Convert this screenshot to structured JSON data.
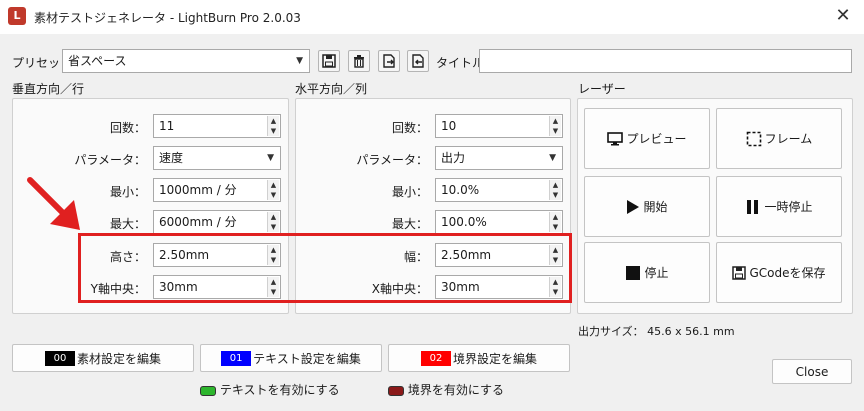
{
  "window": {
    "title": "素材テストジェネレータ - LightBurn Pro 2.0.03",
    "close_glyph": "✕"
  },
  "preset": {
    "label": "プリセット",
    "value": "省スペース",
    "title_label": "タイトル",
    "title_value": ""
  },
  "vertical": {
    "header": "垂直方向／行",
    "count_label": "回数：",
    "count_value": "11",
    "param_label": "パラメータ：",
    "param_value": "速度",
    "min_label": "最小：",
    "min_value": "1000mm / 分",
    "max_label": "最大：",
    "max_value": "6000mm / 分",
    "height_label": "高さ：",
    "height_value": "2.50mm",
    "center_label": "Y軸中央：",
    "center_value": "30mm"
  },
  "horizontal": {
    "header": "水平方向／列",
    "count_label": "回数：",
    "count_value": "10",
    "param_label": "パラメータ：",
    "param_value": "出力",
    "min_label": "最小：",
    "min_value": "10.0%",
    "max_label": "最大：",
    "max_value": "100.0%",
    "width_label": "幅：",
    "width_value": "2.50mm",
    "center_label": "X軸中央：",
    "center_value": "30mm"
  },
  "laser": {
    "header": "レーザー",
    "preview": "プレビュー",
    "frame": "フレーム",
    "start": "開始",
    "pause": "一時停止",
    "stop": "停止",
    "save_gcode": "GCodeを保存",
    "output_size": "出力サイズ： 45.6 x 56.1 mm"
  },
  "edit_buttons": {
    "material": {
      "chip": "00",
      "label": "素材設定を編集",
      "color": "#000000"
    },
    "text": {
      "chip": "01",
      "label": "テキスト設定を編集",
      "color": "#0000ff"
    },
    "border": {
      "chip": "02",
      "label": "境界設定を編集",
      "color": "#ff0000"
    }
  },
  "toggles": {
    "text": {
      "label": "テキストを有効にする",
      "color": "#2db52d"
    },
    "border": {
      "label": "境界を有効にする",
      "color": "#8b1a1a"
    }
  },
  "close_button": "Close",
  "colors": {
    "annotation": "#e02020"
  }
}
